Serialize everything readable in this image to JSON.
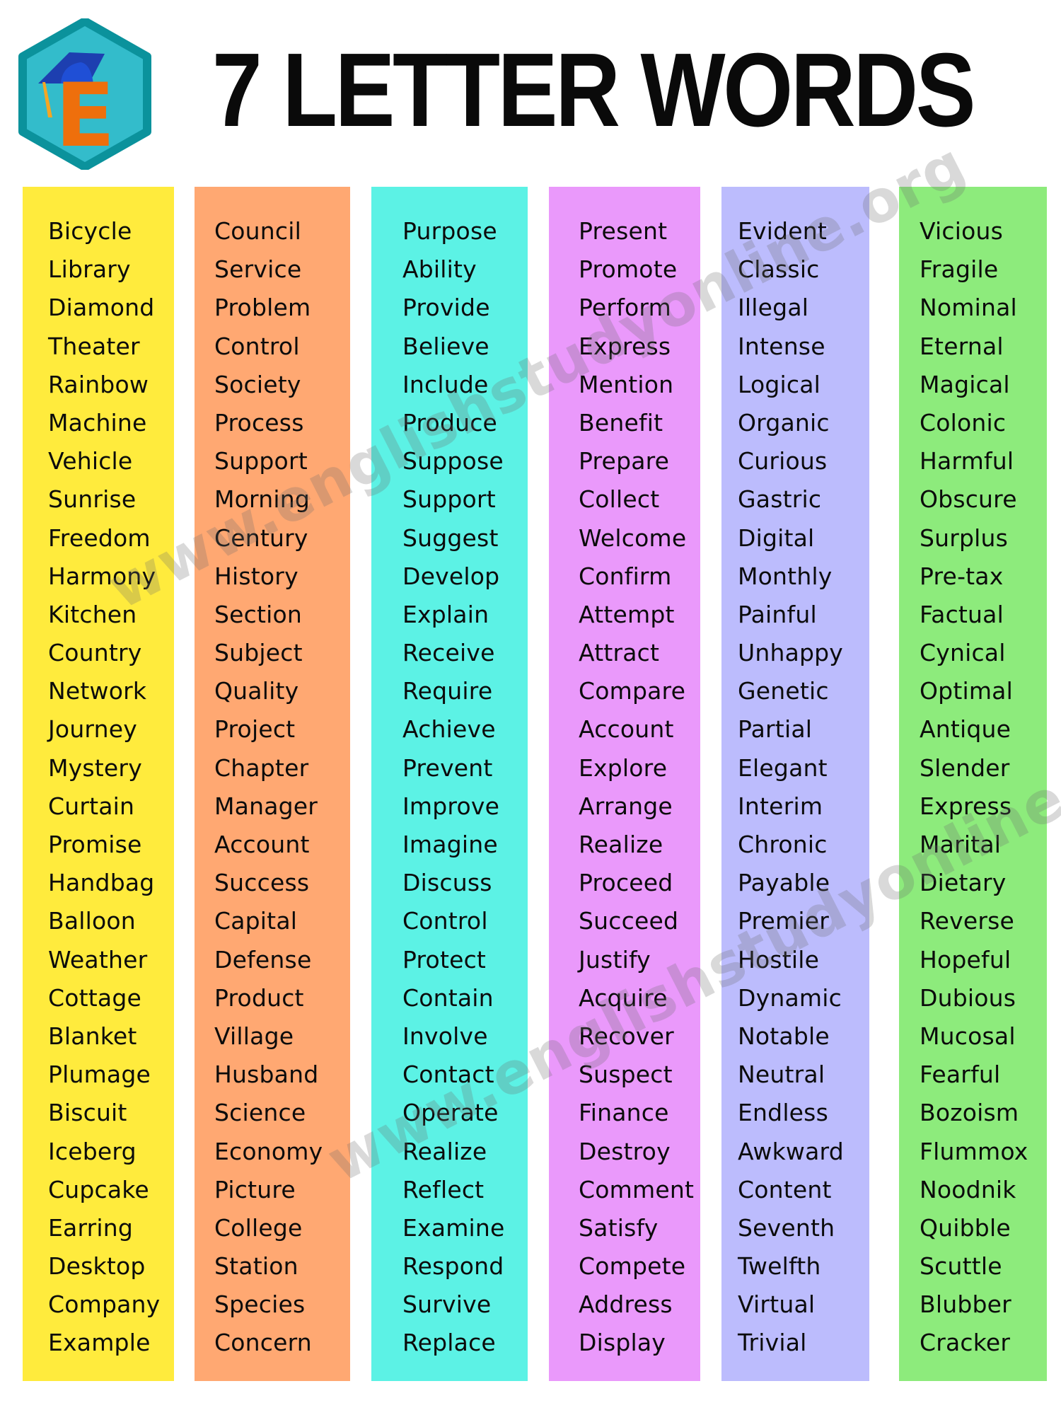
{
  "header": {
    "title": "7 LETTER WORDS",
    "logo": {
      "icon": "graduation-cap-e-logo-icon",
      "letter": "E",
      "colors": {
        "border": "#0b929c",
        "fill": "#33bccb",
        "letter": "#ee6f0c",
        "cap": "#1a44c8",
        "tassel": "#f5a623"
      }
    }
  },
  "watermark": "www.englishstudyonline.org",
  "columns": [
    {
      "color": "#ffeb3d",
      "words": [
        "Bicycle",
        "Library",
        "Diamond",
        "Theater",
        "Rainbow",
        "Machine",
        "Vehicle",
        "Sunrise",
        "Freedom",
        "Harmony",
        "Kitchen",
        "Country",
        "Network",
        "Journey",
        "Mystery",
        "Curtain",
        "Promise",
        "Handbag",
        "Balloon",
        "Weather",
        "Cottage",
        "Blanket",
        "Plumage",
        "Biscuit",
        "Iceberg",
        "Cupcake",
        "Earring",
        "Desktop",
        "Company",
        "Example"
      ]
    },
    {
      "color": "#ffa872",
      "words": [
        "Council",
        "Service",
        "Problem",
        "Control",
        "Society",
        "Process",
        "Support",
        "Morning",
        "Century",
        "History",
        "Section",
        "Subject",
        "Quality",
        "Project",
        "Chapter",
        "Manager",
        "Account",
        "Success",
        "Capital",
        "Defense",
        "Product",
        "Village",
        "Husband",
        "Science",
        "Economy",
        "Picture",
        "College",
        "Station",
        "Species",
        "Concern"
      ]
    },
    {
      "color": "#5cf2e5",
      "words": [
        "Purpose",
        "Ability",
        "Provide",
        "Believe",
        "Include",
        "Produce",
        "Suppose",
        "Support",
        "Suggest",
        "Develop",
        "Explain",
        "Receive",
        "Require",
        "Achieve",
        "Prevent",
        "Improve",
        "Imagine",
        "Discuss",
        "Control",
        "Protect",
        "Contain",
        "Involve",
        "Contact",
        "Operate",
        "Realize",
        "Reflect",
        "Examine",
        "Respond",
        "Survive",
        "Replace"
      ]
    },
    {
      "color": "#ea99fb",
      "words": [
        "Present",
        "Promote",
        "Perform",
        "Express",
        "Mention",
        "Benefit",
        "Prepare",
        "Collect",
        "Welcome",
        "Confirm",
        "Attempt",
        "Attract",
        "Compare",
        "Account",
        "Explore",
        "Arrange",
        "Realize",
        "Proceed",
        "Succeed",
        "Justify",
        "Acquire",
        "Recover",
        "Suspect",
        "Finance",
        "Destroy",
        "Comment",
        "Satisfy",
        "Compete",
        "Address",
        "Display"
      ]
    },
    {
      "color": "#bcbcfd",
      "words": [
        "Evident",
        "Classic",
        "Illegal",
        "Intense",
        "Logical",
        "Organic",
        "Curious",
        "Gastric",
        "Digital",
        "Monthly",
        "Painful",
        "Unhappy",
        "Genetic",
        "Partial",
        "Elegant",
        "Interim",
        "Chronic",
        "Payable",
        "Premier",
        "Hostile",
        "Dynamic",
        "Notable",
        "Neutral",
        "Endless",
        "Awkward",
        "Content",
        "Seventh",
        "Twelfth",
        "Virtual",
        "Trivial"
      ]
    },
    {
      "color": "#8deb7c",
      "words": [
        "Vicious",
        "Fragile",
        "Nominal",
        "Eternal",
        "Magical",
        "Colonic",
        "Harmful",
        "Obscure",
        "Surplus",
        "Pre-tax",
        "Factual",
        "Cynical",
        "Optimal",
        "Antique",
        "Slender",
        "Express",
        "Marital",
        "Dietary",
        "Reverse",
        "Hopeful",
        "Dubious",
        "Mucosal",
        "Fearful",
        "Bozoism",
        "Flummox",
        "Noodnik",
        "Quibble",
        "Scuttle",
        "Blubber",
        "Cracker"
      ]
    }
  ]
}
